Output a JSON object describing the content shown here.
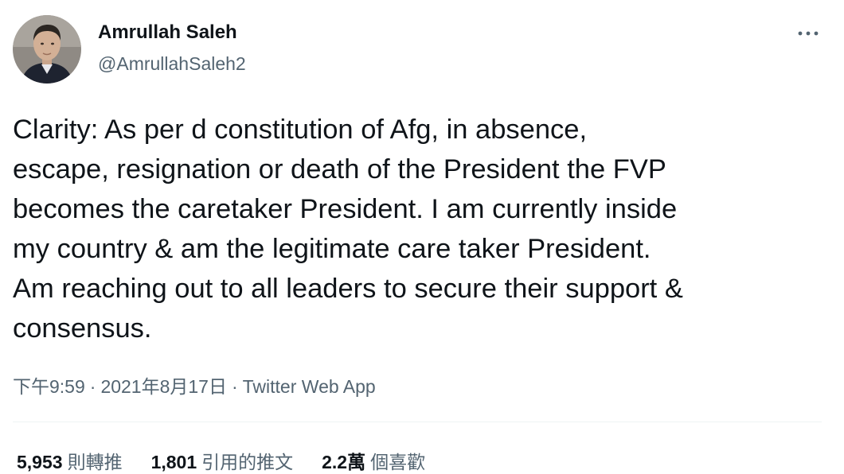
{
  "author": {
    "name": "Amrullah Saleh",
    "handle": "@AmrullahSaleh2"
  },
  "tweet": {
    "lines": [
      "Clarity: As per d constitution of Afg, in absence,",
      "escape, resignation or death of the President the FVP",
      "becomes the caretaker President. I am currently inside",
      "my country & am the legitimate care taker President.",
      "Am reaching out to all leaders to secure their support &",
      "consensus."
    ],
    "time": "下午9:59",
    "date": "2021年8月17日",
    "separator": "·",
    "source": "Twitter Web App"
  },
  "stats": {
    "retweets": {
      "count": "5,953",
      "label": "則轉推"
    },
    "quotes": {
      "count": "1,801",
      "label": "引用的推文"
    },
    "likes": {
      "count": "2.2萬",
      "label": "個喜歡"
    }
  },
  "colors": {
    "text_primary": "#0f1419",
    "text_secondary": "#536471",
    "divider": "#eff3f4"
  },
  "icons": {
    "more": "more-horizontal-dots-icon"
  }
}
